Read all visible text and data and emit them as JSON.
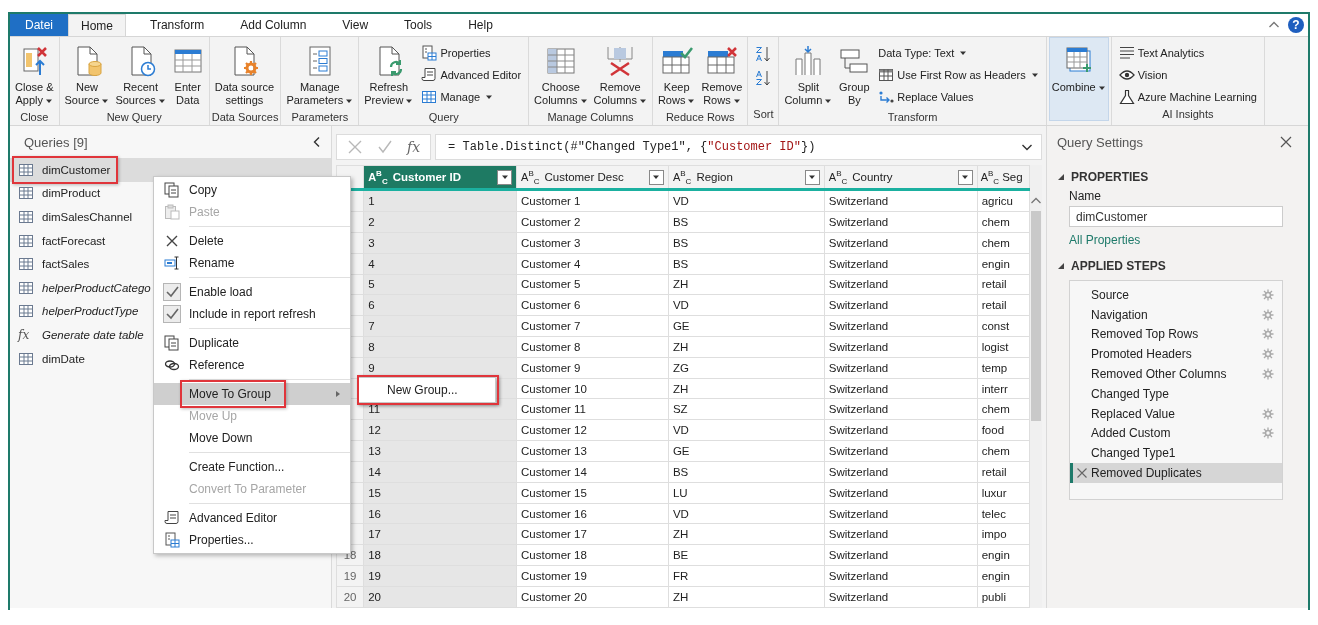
{
  "ribbon": {
    "tabs": [
      {
        "label": "Datei",
        "kind": "file",
        "selected": false
      },
      {
        "label": "Home",
        "kind": "tab",
        "selected": true
      },
      {
        "label": "Transform",
        "kind": "tab",
        "selected": false
      },
      {
        "label": "Add Column",
        "kind": "tab",
        "selected": false
      },
      {
        "label": "View",
        "kind": "tab",
        "selected": false
      },
      {
        "label": "Tools",
        "kind": "tab",
        "selected": false
      },
      {
        "label": "Help",
        "kind": "tab",
        "selected": false
      }
    ],
    "help_button": "?",
    "groups": [
      {
        "label": "Close",
        "buttons": [
          {
            "kind": "close-apply",
            "compact": false,
            "lines": [
              "Close &",
              "Apply"
            ],
            "dropdown": true
          }
        ]
      },
      {
        "label": "New Query",
        "buttons": [
          {
            "kind": "new-source",
            "compact": false,
            "lines": [
              "New",
              "Source"
            ],
            "dropdown": true
          },
          {
            "kind": "recent-sources",
            "compact": false,
            "lines": [
              "Recent",
              "Sources"
            ],
            "dropdown": true
          },
          {
            "kind": "enter-data",
            "compact": false,
            "lines": [
              "Enter",
              "Data"
            ],
            "dropdown": false
          }
        ]
      },
      {
        "label": "Data Sources",
        "buttons": [
          {
            "kind": "datasource-settings",
            "compact": false,
            "lines": [
              "Data source",
              "settings"
            ],
            "dropdown": false
          }
        ]
      },
      {
        "label": "Parameters",
        "buttons": [
          {
            "kind": "manage-params",
            "compact": false,
            "lines": [
              "Manage",
              "Parameters"
            ],
            "dropdown": true
          }
        ]
      },
      {
        "label": "Query",
        "buttons": [
          {
            "kind": "refresh",
            "compact": false,
            "lines": [
              "Refresh",
              "Preview"
            ],
            "dropdown": true
          },
          {
            "kind": "properties",
            "compact": true,
            "lines": [
              "Properties"
            ],
            "dropdown": false
          },
          {
            "kind": "adv-editor",
            "compact": true,
            "lines": [
              "Advanced Editor"
            ],
            "dropdown": false
          },
          {
            "kind": "manage",
            "compact": true,
            "lines": [
              "Manage"
            ],
            "dropdown": true
          }
        ]
      },
      {
        "label": "Manage Columns",
        "buttons": [
          {
            "kind": "choose-cols",
            "compact": false,
            "lines": [
              "Choose",
              "Columns"
            ],
            "dropdown": true
          },
          {
            "kind": "remove-cols",
            "compact": false,
            "lines": [
              "Remove",
              "Columns"
            ],
            "dropdown": true
          }
        ]
      },
      {
        "label": "Reduce Rows",
        "buttons": [
          {
            "kind": "keep-rows",
            "compact": false,
            "lines": [
              "Keep",
              "Rows"
            ],
            "dropdown": true
          },
          {
            "kind": "remove-rows",
            "compact": false,
            "lines": [
              "Remove",
              "Rows"
            ],
            "dropdown": true
          }
        ]
      },
      {
        "label": "Sort",
        "buttons": [
          {
            "kind": "sort-asc",
            "compact": true,
            "dropdown": false
          },
          {
            "kind": "sort-desc",
            "compact": true,
            "dropdown": false
          }
        ]
      },
      {
        "label": "Transform",
        "buttons": [
          {
            "kind": "split-col",
            "compact": false,
            "lines": [
              "Split",
              "Column"
            ],
            "dropdown": true
          },
          {
            "kind": "group-by",
            "compact": false,
            "lines": [
              "Group",
              "By"
            ],
            "dropdown": false
          },
          {
            "kind": "plain",
            "compact": true,
            "lines": [
              "Data Type: Text"
            ],
            "dropdown": true
          },
          {
            "kind": "first-row",
            "compact": true,
            "lines": [
              "Use First Row as Headers"
            ],
            "dropdown": true
          },
          {
            "kind": "replace",
            "compact": true,
            "lines": [
              "Replace Values"
            ],
            "dropdown": false
          }
        ]
      },
      {
        "buttons": [
          {
            "kind": "combine",
            "compact": false,
            "lines": [
              "Combine"
            ],
            "dropdown": true,
            "highlighted": true
          }
        ]
      },
      {
        "label": "AI Insights",
        "buttons": [
          {
            "kind": "text-analytics",
            "compact": true,
            "lines": [
              "Text Analytics"
            ],
            "dropdown": false
          },
          {
            "kind": "vision",
            "compact": true,
            "lines": [
              "Vision"
            ],
            "dropdown": false
          },
          {
            "kind": "azure-ml",
            "compact": true,
            "lines": [
              "Azure Machine Learning"
            ],
            "dropdown": false
          }
        ]
      }
    ]
  },
  "queries_panel": {
    "title": "Queries [9]",
    "items": [
      {
        "label": "dimCustomer",
        "kind": "table",
        "selected": true,
        "annotated": true,
        "load_disabled": false
      },
      {
        "label": "dimProduct",
        "kind": "table",
        "selected": false,
        "annotated": false,
        "load_disabled": false
      },
      {
        "label": "dimSalesChannel",
        "kind": "table",
        "selected": false,
        "annotated": false,
        "load_disabled": false
      },
      {
        "label": "factForecast",
        "kind": "table",
        "selected": false,
        "annotated": false,
        "load_disabled": false
      },
      {
        "label": "factSales",
        "kind": "table",
        "selected": false,
        "annotated": false,
        "load_disabled": false
      },
      {
        "label": "helperProductCatego",
        "kind": "table",
        "selected": false,
        "annotated": false,
        "load_disabled": true
      },
      {
        "label": "helperProductType",
        "kind": "table",
        "selected": false,
        "annotated": false,
        "load_disabled": true
      },
      {
        "label": "Generate date table",
        "kind": "function",
        "prefix": "fx",
        "selected": false,
        "annotated": false,
        "load_disabled": true
      },
      {
        "label": "dimDate",
        "kind": "table",
        "selected": false,
        "annotated": false,
        "load_disabled": false
      }
    ]
  },
  "formula_bar": {
    "function_label": "fx",
    "parts": [
      {
        "text": "= Table.Distinct(#\"Changed Type1\", {",
        "kind": "code"
      },
      {
        "text": "\"Customer ID\"",
        "kind": "string"
      },
      {
        "text": "})",
        "kind": "code"
      }
    ]
  },
  "table": {
    "columns": [
      {
        "label": "Customer ID",
        "type": "A$^{B}$$_{C}$",
        "selected": true,
        "filter": true
      },
      {
        "label": "Customer Desc",
        "type": "A$^{B}$$_{C}$",
        "selected": false,
        "filter": true
      },
      {
        "label": "Region",
        "type": "A$^{B}$$_{C}$",
        "selected": false,
        "filter": true
      },
      {
        "label": "Country",
        "type": "A$^{B}$$_{C}$",
        "selected": false,
        "filter": true
      },
      {
        "label": "Seg",
        "type": "A$^{B}$$_{C}$",
        "selected": false,
        "filter": false
      }
    ],
    "rows": [
      {
        "cells": [
          "1",
          "Customer 1",
          "VD",
          "Switzerland",
          "agricu"
        ]
      },
      {
        "cells": [
          "2",
          "Customer 2",
          "BS",
          "Switzerland",
          "chem"
        ]
      },
      {
        "cells": [
          "3",
          "Customer 3",
          "BS",
          "Switzerland",
          "chem"
        ]
      },
      {
        "cells": [
          "4",
          "Customer 4",
          "BS",
          "Switzerland",
          "engin"
        ]
      },
      {
        "cells": [
          "5",
          "Customer 5",
          "ZH",
          "Switzerland",
          "retail"
        ]
      },
      {
        "cells": [
          "6",
          "Customer 6",
          "VD",
          "Switzerland",
          "retail"
        ]
      },
      {
        "cells": [
          "7",
          "Customer 7",
          "GE",
          "Switzerland",
          "const"
        ]
      },
      {
        "cells": [
          "8",
          "Customer 8",
          "ZH",
          "Switzerland",
          "logist"
        ]
      },
      {
        "cells": [
          "9",
          "Customer 9",
          "ZG",
          "Switzerland",
          "temp"
        ]
      },
      {
        "cells": [
          null,
          "Customer 10",
          "ZH",
          "Switzerland",
          "interr"
        ]
      },
      {
        "cells": [
          "11",
          "Customer 11",
          "SZ",
          "Switzerland",
          "chem"
        ]
      },
      {
        "cells": [
          "12",
          "Customer 12",
          "VD",
          "Switzerland",
          "food"
        ]
      },
      {
        "cells": [
          "13",
          "Customer 13",
          "GE",
          "Switzerland",
          "chem"
        ]
      },
      {
        "cells": [
          "14",
          "Customer 14",
          "BS",
          "Switzerland",
          "retail"
        ]
      },
      {
        "cells": [
          "15",
          "Customer 15",
          "LU",
          "Switzerland",
          "luxur"
        ]
      },
      {
        "cells": [
          "16",
          "Customer 16",
          "VD",
          "Switzerland",
          "telec"
        ]
      },
      {
        "cells": [
          "17",
          "Customer 17",
          "ZH",
          "Switzerland",
          "impo"
        ]
      },
      {
        "number": "18",
        "cells": [
          "18",
          "Customer 18",
          "BE",
          "Switzerland",
          "engin"
        ]
      },
      {
        "number": "19",
        "cells": [
          "19",
          "Customer 19",
          "FR",
          "Switzerland",
          "engin"
        ]
      },
      {
        "number": "20",
        "cells": [
          "20",
          "Customer 20",
          "ZH",
          "Switzerland",
          "publi"
        ]
      }
    ]
  },
  "query_settings": {
    "title": "Query Settings",
    "properties_heading": "PROPERTIES",
    "name_label": "Name",
    "name_value": "dimCustomer",
    "all_properties_link": "All Properties",
    "steps_heading": "APPLIED STEPS",
    "steps": [
      {
        "label": "Source",
        "settings": true,
        "selected": false
      },
      {
        "label": "Navigation",
        "settings": true,
        "selected": false
      },
      {
        "label": "Removed Top Rows",
        "settings": true,
        "selected": false
      },
      {
        "label": "Promoted Headers",
        "settings": true,
        "selected": false
      },
      {
        "label": "Removed Other Columns",
        "settings": true,
        "selected": false
      },
      {
        "label": "Changed Type",
        "settings": false,
        "selected": false
      },
      {
        "label": "Replaced Value",
        "settings": true,
        "selected": false
      },
      {
        "label": "Added Custom",
        "settings": true,
        "selected": false
      },
      {
        "label": "Changed Type1",
        "settings": false,
        "selected": false
      },
      {
        "label": "Removed Duplicates",
        "settings": false,
        "selected": true
      }
    ]
  },
  "context_menu": {
    "groups": [
      [
        {
          "label": "Copy",
          "kind": "copy",
          "disabled": false,
          "selected": false
        },
        {
          "label": "Paste",
          "kind": "paste",
          "disabled": true,
          "selected": false
        }
      ],
      [
        {
          "label": "Delete",
          "kind": "delete",
          "disabled": false,
          "selected": false
        },
        {
          "label": "Rename",
          "kind": "rename",
          "disabled": false,
          "selected": false
        }
      ],
      [
        {
          "label": "Enable load",
          "kind": "check",
          "checked": true,
          "disabled": false,
          "selected": false
        },
        {
          "label": "Include in report refresh",
          "kind": "check",
          "checked": true,
          "disabled": false,
          "selected": false
        }
      ],
      [
        {
          "label": "Duplicate",
          "kind": "copy",
          "disabled": false,
          "selected": false
        },
        {
          "label": "Reference",
          "kind": "reference",
          "disabled": false,
          "selected": false
        }
      ],
      [
        {
          "label": "Move To Group",
          "kind": "none",
          "submenu": true,
          "annotated": true,
          "disabled": false,
          "selected": true
        },
        {
          "label": "Move Up",
          "kind": "none",
          "disabled": true,
          "selected": false
        },
        {
          "label": "Move Down",
          "kind": "none",
          "disabled": false,
          "selected": false
        }
      ],
      [
        {
          "label": "Create Function...",
          "kind": "none",
          "disabled": false,
          "selected": false
        },
        {
          "label": "Convert To Parameter",
          "kind": "none",
          "disabled": true,
          "selected": false
        }
      ],
      [
        {
          "label": "Advanced Editor",
          "kind": "adv-editor",
          "disabled": false,
          "selected": false
        },
        {
          "label": "Properties...",
          "kind": "properties",
          "disabled": false,
          "selected": false
        }
      ]
    ],
    "submenu": {
      "items": [
        {
          "label": "New Group...",
          "annotated": true
        }
      ]
    }
  }
}
